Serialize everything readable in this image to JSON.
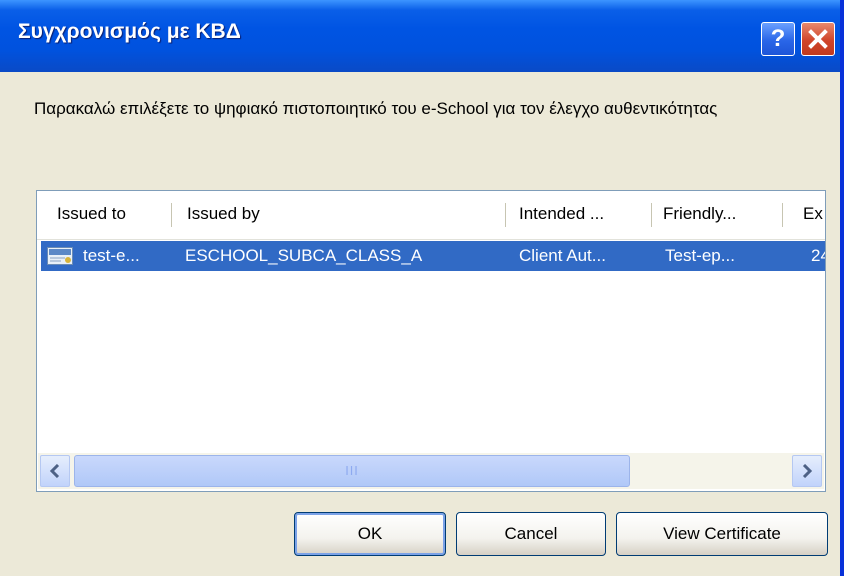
{
  "window": {
    "title": "Συγχρονισμός με ΚΒΔ",
    "help_label": "?"
  },
  "message": "Παρακαλώ επιλέξετε το ψηφιακό πιστοποιητικό του e-School για τον έλεγχο αυθεντικότητας",
  "list": {
    "columns": [
      "Issued to",
      "Issued by",
      "Intended ...",
      "Friendly...",
      "Ex"
    ],
    "rows": [
      {
        "issued_to": "test-e...",
        "issued_by": "ESCHOOL_SUBCA_CLASS_A",
        "intended": "Client Aut...",
        "friendly": "Test-ep...",
        "expiry": "24,",
        "icon": "certificate-icon",
        "selected": true
      }
    ],
    "scroll_grip": "III"
  },
  "buttons": {
    "ok": "OK",
    "cancel": "Cancel",
    "view": "View Certificate"
  },
  "colors": {
    "titlebar": "#0054e3",
    "selection": "#316ac5",
    "window_bg": "#ece9d8"
  }
}
